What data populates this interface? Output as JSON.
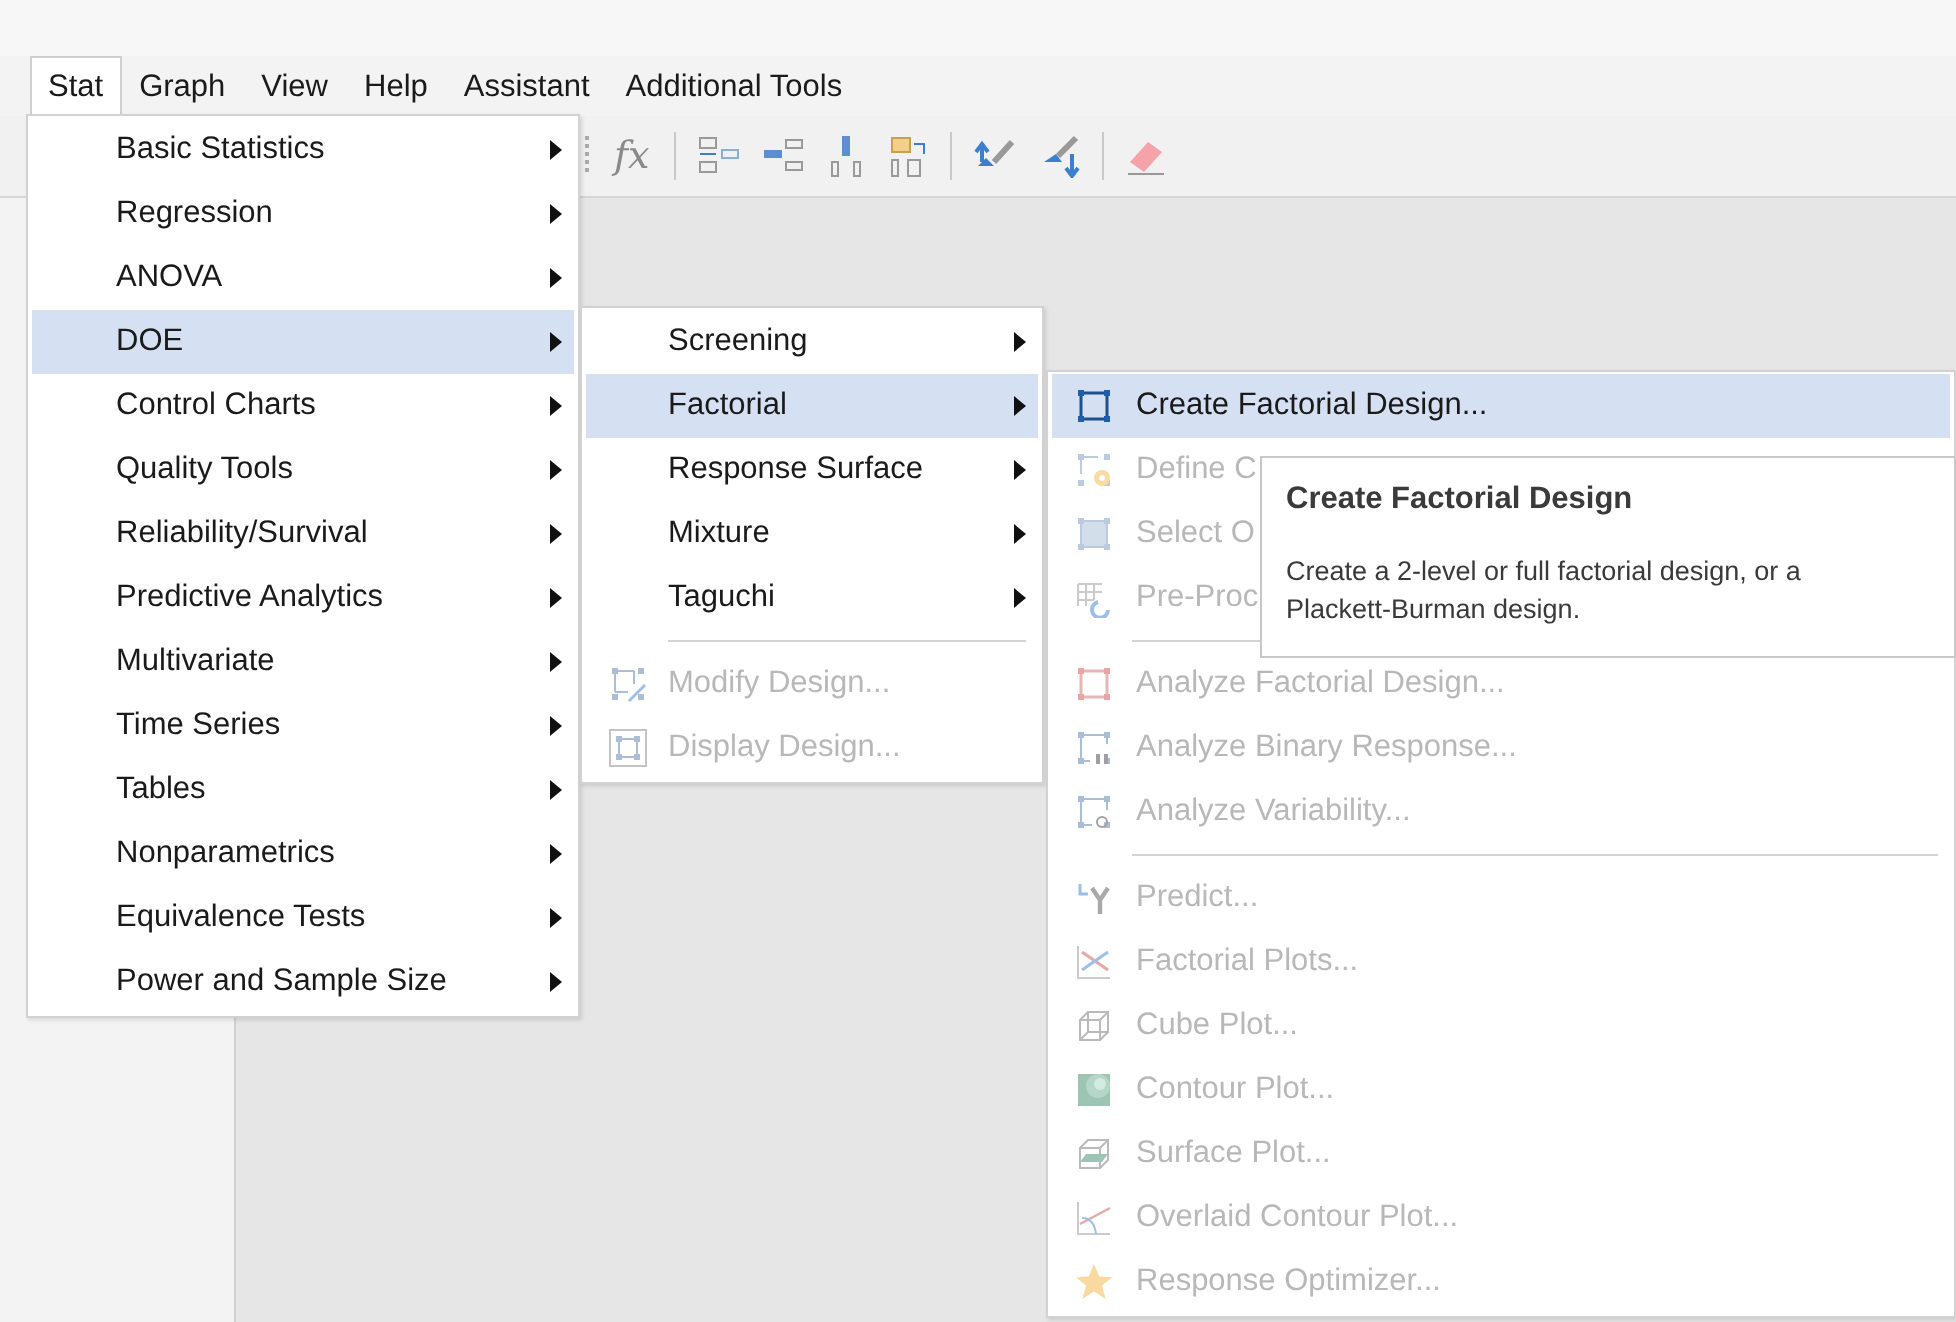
{
  "menu_bar": [
    {
      "label": "Stat",
      "selected": true
    },
    {
      "label": "Graph",
      "selected": false
    },
    {
      "label": "View",
      "selected": false
    },
    {
      "label": "Help",
      "selected": false
    },
    {
      "label": "Assistant",
      "selected": false
    },
    {
      "label": "Additional Tools",
      "selected": false
    }
  ],
  "toolbar": {
    "function_button": "fx"
  },
  "stat_menu": {
    "items": [
      {
        "label": "Basic Statistics",
        "selected": false,
        "has_submenu": true
      },
      {
        "label": "Regression",
        "selected": false,
        "has_submenu": true
      },
      {
        "label": "ANOVA",
        "selected": false,
        "has_submenu": true
      },
      {
        "label": "DOE",
        "selected": true,
        "has_submenu": true
      },
      {
        "label": "Control Charts",
        "selected": false,
        "has_submenu": true
      },
      {
        "label": "Quality Tools",
        "selected": false,
        "has_submenu": true
      },
      {
        "label": "Reliability/Survival",
        "selected": false,
        "has_submenu": true
      },
      {
        "label": "Predictive Analytics",
        "selected": false,
        "has_submenu": true
      },
      {
        "label": "Multivariate",
        "selected": false,
        "has_submenu": true
      },
      {
        "label": "Time Series",
        "selected": false,
        "has_submenu": true
      },
      {
        "label": "Tables",
        "selected": false,
        "has_submenu": true
      },
      {
        "label": "Nonparametrics",
        "selected": false,
        "has_submenu": true
      },
      {
        "label": "Equivalence Tests",
        "selected": false,
        "has_submenu": true
      },
      {
        "label": "Power and Sample Size",
        "selected": false,
        "has_submenu": true
      }
    ]
  },
  "doe_menu": {
    "items": [
      {
        "kind": "item",
        "label": "Screening",
        "selected": false,
        "disabled": false,
        "has_submenu": true
      },
      {
        "kind": "item",
        "label": "Factorial",
        "selected": true,
        "disabled": false,
        "has_submenu": true
      },
      {
        "kind": "item",
        "label": "Response Surface",
        "selected": false,
        "disabled": false,
        "has_submenu": true
      },
      {
        "kind": "item",
        "label": "Mixture",
        "selected": false,
        "disabled": false,
        "has_submenu": true
      },
      {
        "kind": "item",
        "label": "Taguchi",
        "selected": false,
        "disabled": false,
        "has_submenu": true
      },
      {
        "kind": "separator"
      },
      {
        "kind": "item",
        "label": "Modify Design...",
        "selected": false,
        "disabled": true,
        "has_submenu": false
      },
      {
        "kind": "item",
        "label": "Display Design...",
        "selected": false,
        "disabled": true,
        "has_submenu": false
      }
    ]
  },
  "factorial_menu": {
    "items": [
      {
        "kind": "item",
        "label": "Create Factorial Design...",
        "selected": true,
        "disabled": false
      },
      {
        "kind": "item",
        "label": "Define C",
        "selected": false,
        "disabled": true
      },
      {
        "kind": "item",
        "label": "Select O",
        "selected": false,
        "disabled": true
      },
      {
        "kind": "item",
        "label": "Pre-Proc",
        "selected": false,
        "disabled": true
      },
      {
        "kind": "separator"
      },
      {
        "kind": "item",
        "label": "Analyze Factorial Design...",
        "selected": false,
        "disabled": true
      },
      {
        "kind": "item",
        "label": "Analyze Binary Response...",
        "selected": false,
        "disabled": true
      },
      {
        "kind": "item",
        "label": "Analyze Variability...",
        "selected": false,
        "disabled": true
      },
      {
        "kind": "separator"
      },
      {
        "kind": "item",
        "label": "Predict...",
        "selected": false,
        "disabled": true
      },
      {
        "kind": "item",
        "label": "Factorial Plots...",
        "selected": false,
        "disabled": true
      },
      {
        "kind": "item",
        "label": "Cube Plot...",
        "selected": false,
        "disabled": true
      },
      {
        "kind": "item",
        "label": "Contour Plot...",
        "selected": false,
        "disabled": true
      },
      {
        "kind": "item",
        "label": "Surface Plot...",
        "selected": false,
        "disabled": true
      },
      {
        "kind": "item",
        "label": "Overlaid Contour Plot...",
        "selected": false,
        "disabled": true
      },
      {
        "kind": "item",
        "label": "Response Optimizer...",
        "selected": false,
        "disabled": true
      }
    ]
  },
  "tooltip": {
    "title": "Create Factorial Design",
    "text": "Create a 2-level or full factorial design, or a Plackett-Burman design."
  }
}
